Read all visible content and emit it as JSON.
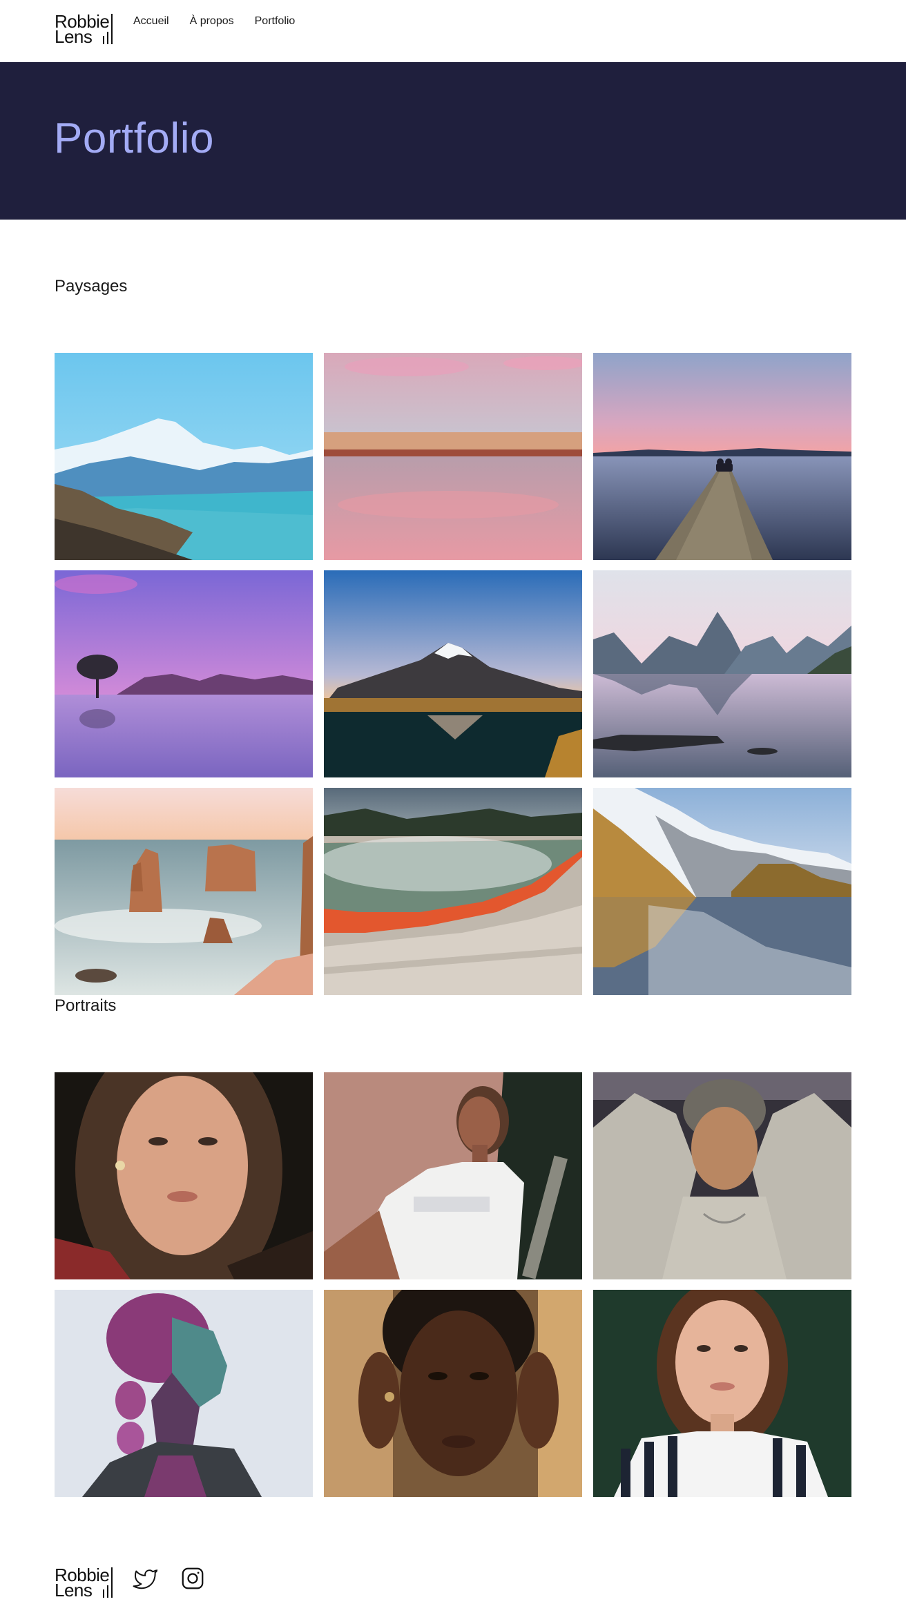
{
  "brand": {
    "line1": "Robbie",
    "line2": "Lens"
  },
  "nav": {
    "items": [
      "Accueil",
      "À propos",
      "Portfolio"
    ]
  },
  "hero": {
    "title": "Portfolio",
    "background": "#1f1f3d",
    "title_color": "#a3abf5"
  },
  "sections": {
    "landscapes": {
      "title": "Paysages",
      "photos": [
        "mountain-turquoise-lake-photo",
        "pink-sky-beach-reflection-photo",
        "couple-on-jetty-sunset-photo",
        "lone-tree-purple-lake-photo",
        "snow-volcano-reflection-photo",
        "fjord-peaks-reflection-photo",
        "sea-stacks-coast-photo",
        "geothermal-pool-steam-photo",
        "snowy-mountain-reflection-photo"
      ]
    },
    "portraits": {
      "title": "Portraits",
      "photos": [
        "woman-dark-hair-portrait-photo",
        "woman-white-tshirt-portrait-photo",
        "man-beanie-portrait-photo",
        "woman-purple-hair-profile-photo",
        "woman-braids-portrait-photo",
        "woman-striped-shirt-portrait-photo"
      ]
    }
  },
  "footer": {
    "social_icons": [
      "twitter-icon",
      "instagram-icon"
    ]
  }
}
